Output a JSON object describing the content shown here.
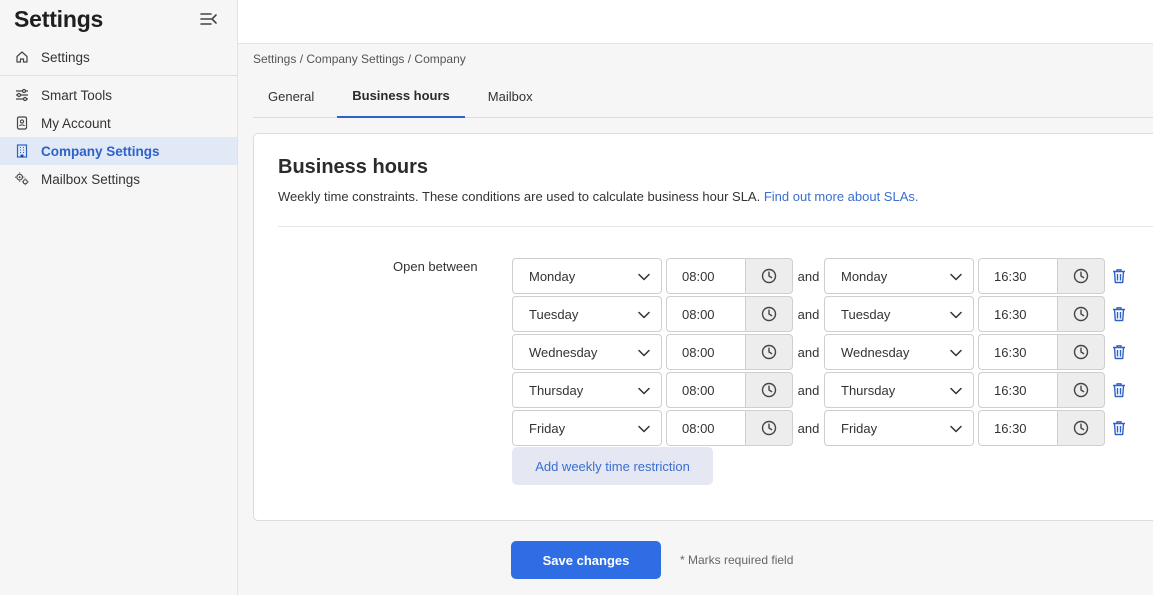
{
  "sidebar": {
    "title": "Settings",
    "items": [
      {
        "label": "Settings",
        "icon": "home-icon"
      },
      {
        "label": "Smart Tools",
        "icon": "sliders-icon"
      },
      {
        "label": "My Account",
        "icon": "badge-icon"
      },
      {
        "label": "Company Settings",
        "icon": "building-icon",
        "active": true
      },
      {
        "label": "Mailbox Settings",
        "icon": "gears-icon"
      }
    ]
  },
  "breadcrumb": "Settings / Company Settings / Company",
  "tabs": [
    {
      "label": "General"
    },
    {
      "label": "Business hours",
      "active": true
    },
    {
      "label": "Mailbox"
    }
  ],
  "card": {
    "title": "Business hours",
    "description": "Weekly time constraints. These conditions are used to calculate business hour SLA. ",
    "link": "Find out more about SLAs."
  },
  "form": {
    "open_label": "Open between",
    "and_label": "and",
    "rows": [
      {
        "start_day": "Monday",
        "start_time": "08:00",
        "end_day": "Monday",
        "end_time": "16:30"
      },
      {
        "start_day": "Tuesday",
        "start_time": "08:00",
        "end_day": "Tuesday",
        "end_time": "16:30"
      },
      {
        "start_day": "Wednesday",
        "start_time": "08:00",
        "end_day": "Wednesday",
        "end_time": "16:30"
      },
      {
        "start_day": "Thursday",
        "start_time": "08:00",
        "end_day": "Thursday",
        "end_time": "16:30"
      },
      {
        "start_day": "Friday",
        "start_time": "08:00",
        "end_day": "Friday",
        "end_time": "16:30"
      }
    ],
    "add_label": "Add weekly time restriction"
  },
  "footer": {
    "save_label": "Save changes",
    "required_note": "* Marks required field"
  },
  "colors": {
    "accent": "#2e6de4",
    "link": "#3a6fd0",
    "active_bg": "#e1e9f7"
  }
}
